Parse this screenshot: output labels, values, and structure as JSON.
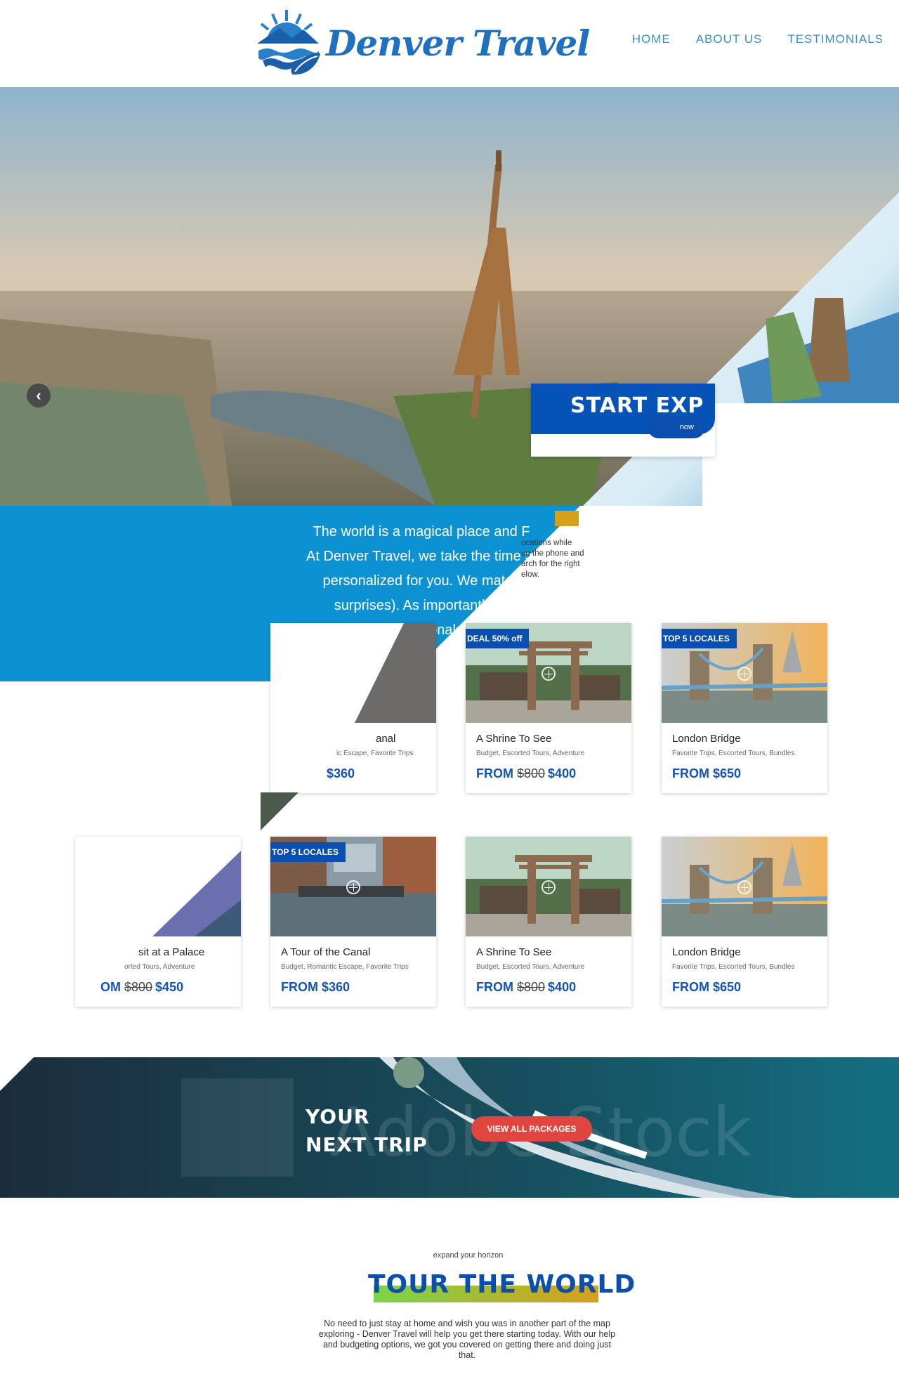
{
  "brand": {
    "logo_text": "Denver Travel",
    "primary": "#1f70c1",
    "accent": "#0a4fb0",
    "highlight": "#d6a01b",
    "cta_red": "#e0453f"
  },
  "nav": {
    "items": [
      {
        "label": "HOME"
      },
      {
        "label": "ABOUT US"
      },
      {
        "label": "TESTIMONIALS"
      }
    ]
  },
  "hero": {
    "prev_icon": "chevron-left-icon",
    "cta_title": "START EXP",
    "cta_button": "now"
  },
  "intro": {
    "lines": [
      "The world is a magical place and F",
      "At Denver Travel, we take the time to",
      "personalized for you. We match",
      "surprises). As importantly, w",
      "professionals"
    ],
    "side_text": [
      "ocations while",
      "up the phone and",
      "arch for the right",
      "elow."
    ]
  },
  "cards_row1": [
    {
      "title": "anal",
      "tags": "ic Escape, Favorite Trips",
      "price_prefix": "",
      "old_price": "",
      "price": "$360",
      "badge": ""
    },
    {
      "title": "A Shrine To See",
      "tags": "Budget, Escorted Tours, Adventure",
      "price_prefix": "FROM ",
      "old_price": "$800",
      "price": "$400",
      "badge": "DEAL 50% off"
    },
    {
      "title": "London Bridge",
      "tags": "Favorite Trips, Escorted Tours, Bundles",
      "price_prefix": "FROM ",
      "old_price": "",
      "price": "$650",
      "badge": "TOP 5 LOCALES"
    }
  ],
  "cards_row2": [
    {
      "title": "sit at a Palace",
      "tags": "orted Tours, Adventure",
      "price_prefix": "OM ",
      "old_price": "$800",
      "price": "$450",
      "badge": ""
    },
    {
      "title": "A Tour of the Canal",
      "tags": "Budget, Romantic Escape, Favorite Trips",
      "price_prefix": "FROM ",
      "old_price": "",
      "price": "$360",
      "badge": "TOP 5 LOCALES"
    },
    {
      "title": "A Shrine To See",
      "tags": "Budget, Escorted Tours, Adventure",
      "price_prefix": "FROM ",
      "old_price": "$800",
      "price": "$400",
      "badge": ""
    },
    {
      "title": "London Bridge",
      "tags": "Favorite Trips, Escorted Tours, Bundles",
      "price_prefix": "FROM ",
      "old_price": "",
      "price": "$650",
      "badge": ""
    }
  ],
  "banner": {
    "title_line1": "YOUR",
    "title_line2": "NEXT TRIP",
    "button": "VIEW ALL PACKAGES",
    "watermark": "Adobe Stock"
  },
  "tour": {
    "eyebrow": "expand your horizon",
    "title": "TOUR THE WORLD",
    "description": "No need to just stay at home and wish you was in another part of the map exploring - Denver Travel will help you get there starting today. With our help and budgeting options, we got you covered on getting there and doing just that."
  }
}
